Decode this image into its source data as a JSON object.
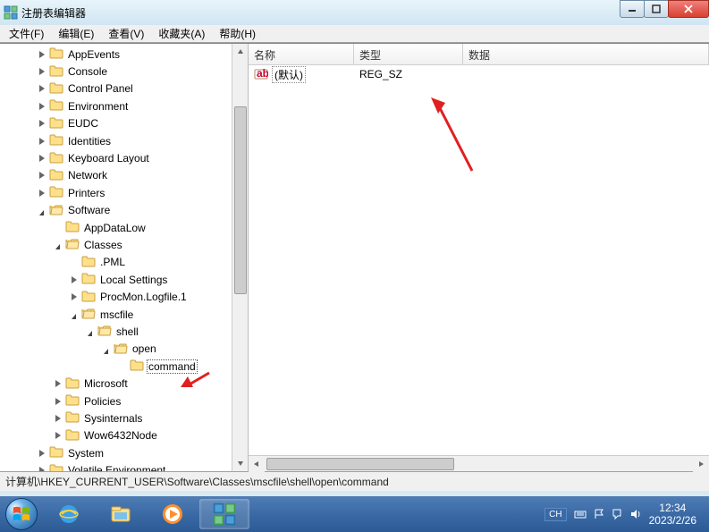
{
  "window": {
    "title": "注册表编辑器"
  },
  "menu": {
    "file": "文件(F)",
    "edit": "编辑(E)",
    "view": "查看(V)",
    "favorites": "收藏夹(A)",
    "help": "帮助(H)"
  },
  "tree": {
    "items": [
      {
        "level": 2,
        "toggle": "closed",
        "label": "AppEvents"
      },
      {
        "level": 2,
        "toggle": "closed",
        "label": "Console"
      },
      {
        "level": 2,
        "toggle": "closed",
        "label": "Control Panel"
      },
      {
        "level": 2,
        "toggle": "closed",
        "label": "Environment"
      },
      {
        "level": 2,
        "toggle": "closed",
        "label": "EUDC"
      },
      {
        "level": 2,
        "toggle": "closed",
        "label": "Identities"
      },
      {
        "level": 2,
        "toggle": "closed",
        "label": "Keyboard Layout"
      },
      {
        "level": 2,
        "toggle": "closed",
        "label": "Network"
      },
      {
        "level": 2,
        "toggle": "closed",
        "label": "Printers"
      },
      {
        "level": 2,
        "toggle": "open",
        "label": "Software"
      },
      {
        "level": 3,
        "toggle": "none",
        "label": "AppDataLow"
      },
      {
        "level": 3,
        "toggle": "open",
        "label": "Classes"
      },
      {
        "level": 4,
        "toggle": "none",
        "label": ".PML"
      },
      {
        "level": 4,
        "toggle": "closed",
        "label": "Local Settings"
      },
      {
        "level": 4,
        "toggle": "closed",
        "label": "ProcMon.Logfile.1"
      },
      {
        "level": 4,
        "toggle": "open",
        "label": "mscfile"
      },
      {
        "level": 5,
        "toggle": "open",
        "label": "shell"
      },
      {
        "level": 6,
        "toggle": "open",
        "label": "open"
      },
      {
        "level": 7,
        "toggle": "none",
        "label": "command",
        "selected": true
      },
      {
        "level": 3,
        "toggle": "closed",
        "label": "Microsoft"
      },
      {
        "level": 3,
        "toggle": "closed",
        "label": "Policies"
      },
      {
        "level": 3,
        "toggle": "closed",
        "label": "Sysinternals"
      },
      {
        "level": 3,
        "toggle": "closed",
        "label": "Wow6432Node"
      },
      {
        "level": 2,
        "toggle": "closed",
        "label": "System"
      },
      {
        "level": 2,
        "toggle": "closed",
        "label": "Volatile Environment"
      }
    ]
  },
  "list": {
    "columns": {
      "name": "名称",
      "type": "类型",
      "data": "数据"
    },
    "rows": [
      {
        "name": "(默认)",
        "type": "REG_SZ",
        "data": ""
      }
    ]
  },
  "statusbar": {
    "path": "计算机\\HKEY_CURRENT_USER\\Software\\Classes\\mscfile\\shell\\open\\command"
  },
  "taskbar": {
    "lang": "CH",
    "time": "12:34",
    "date": "2023/2/26"
  }
}
